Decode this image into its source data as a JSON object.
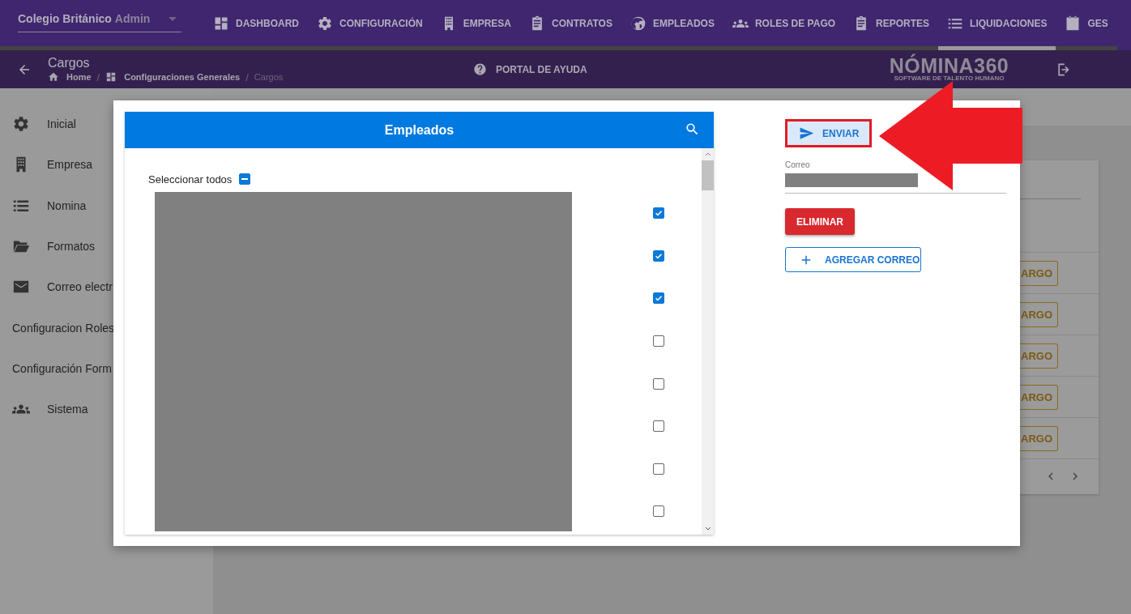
{
  "header": {
    "brand": "Colegio Británico",
    "role": "Admin"
  },
  "nav": [
    {
      "label": "DASHBOARD",
      "selected": false
    },
    {
      "label": "CONFIGURACIÓN",
      "selected": false
    },
    {
      "label": "EMPRESA",
      "selected": false
    },
    {
      "label": "CONTRATOS",
      "selected": false
    },
    {
      "label": "EMPLEADOS",
      "selected": false
    },
    {
      "label": "ROLES DE PAGO",
      "selected": false
    },
    {
      "label": "REPORTES",
      "selected": false
    },
    {
      "label": "LIQUIDACIONES",
      "selected": true
    },
    {
      "label": "GES",
      "selected": false
    }
  ],
  "subheader": {
    "title": "Cargos",
    "breadcrumb_separator": "/",
    "breadcrumbs": [
      {
        "label": "Home"
      },
      {
        "label": "Configuraciones Generales"
      },
      {
        "label": "Cargos"
      }
    ],
    "help": "PORTAL DE AYUDA",
    "logo": {
      "name": "NÓMINA360",
      "tagline": "SOFTWARE DE TALENTO HUMANO"
    }
  },
  "sidebar": [
    {
      "label": "Inicial"
    },
    {
      "label": "Empresa"
    },
    {
      "label": "Nomina"
    },
    {
      "label": "Formatos"
    },
    {
      "label": "Correo electr"
    },
    {
      "label": "Configuracion Roles"
    },
    {
      "label": "Configuración Form"
    },
    {
      "label": "Sistema"
    }
  ],
  "background_rows": [
    {
      "button": "ARGO"
    },
    {
      "button": "ARGO"
    },
    {
      "button": "ARGO"
    },
    {
      "button": "ARGO"
    },
    {
      "button": "ARGO"
    }
  ],
  "dialog": {
    "list": {
      "title": "Empleados",
      "select_all": {
        "label": "Seleccionar todos",
        "indeterminate": true
      },
      "rows": [
        {
          "checked": true
        },
        {
          "checked": true
        },
        {
          "checked": true
        },
        {
          "checked": false
        },
        {
          "checked": false
        },
        {
          "checked": false
        },
        {
          "checked": false
        },
        {
          "checked": false
        }
      ]
    },
    "send_button": "ENVIAR",
    "email_field": {
      "label": "Correo"
    },
    "delete_button": "ELIMINAR",
    "add_button": "AGREGAR CORREO"
  }
}
